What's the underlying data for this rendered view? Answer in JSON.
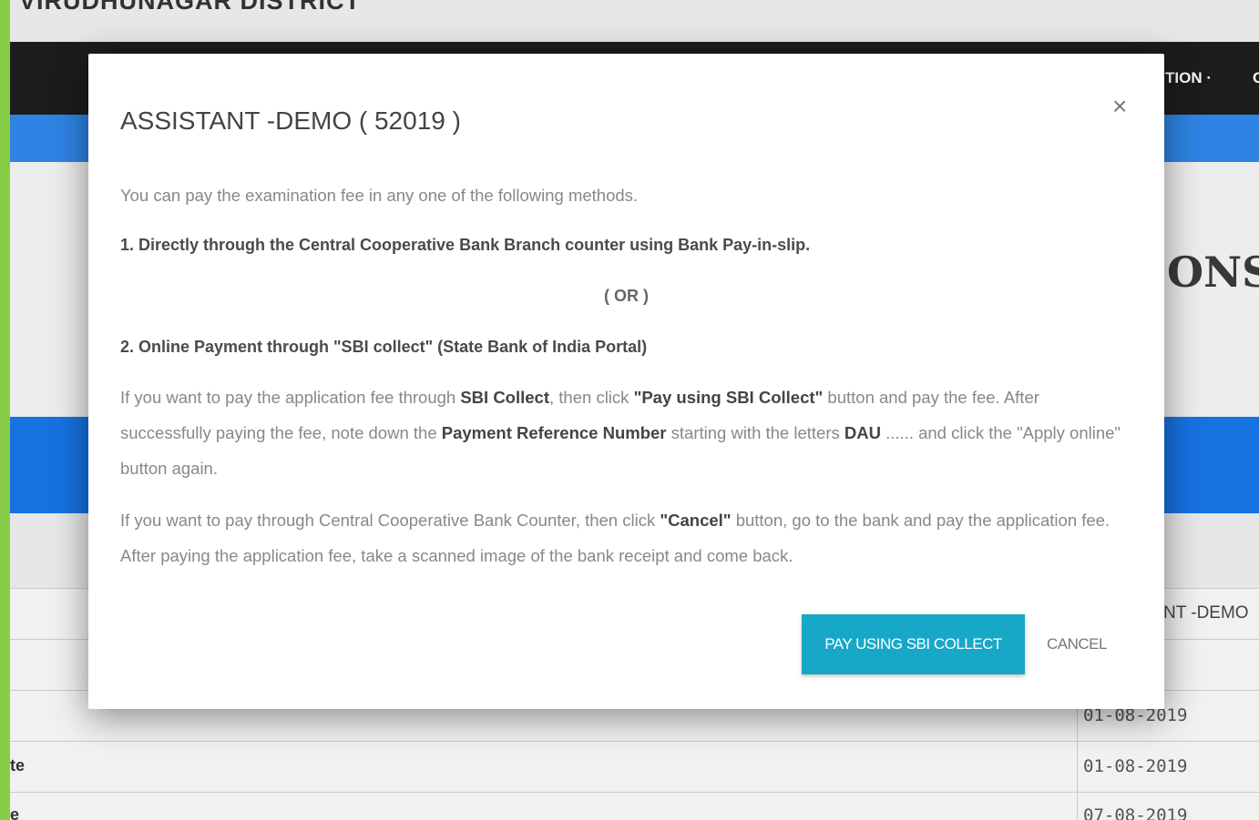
{
  "background": {
    "district_title": "VIRUDHUNAGAR DISTRICT",
    "nav_items": [
      "TION ·",
      "C"
    ],
    "heading_fragment": "ONS",
    "table": {
      "header_fragment": "NT -DEMO",
      "rows": [
        {
          "left": "",
          "date": "01-08-2019"
        },
        {
          "left": "te",
          "date": "01-08-2019"
        },
        {
          "left": "e",
          "date": "07-08-2019"
        }
      ]
    }
  },
  "modal": {
    "title": "ASSISTANT -DEMO ( 52019 )",
    "close_symbol": "×",
    "intro": "You can pay the examination fee in any one of the following methods.",
    "option1": "1. Directly through the Central Cooperative Bank Branch counter using Bank Pay-in-slip.",
    "or_text": "( OR )",
    "option2": "2. Online Payment through \"SBI collect\" (State Bank of India Portal)",
    "sbi_para": {
      "part1": "If you want to pay the application fee through ",
      "sbi_collect": "SBI Collect",
      "part2": ", then click ",
      "pay_label": "\"Pay using SBI Collect\"",
      "part3": " button and pay the fee. After successfully paying the fee, note down the ",
      "ref_number": "Payment Reference Number",
      "part4": " starting with the letters ",
      "dau": "DAU",
      "part5": " ...... and click the \"Apply online\" button again."
    },
    "bank_para": {
      "part1": "If you want to pay through Central Cooperative Bank Counter, then click ",
      "cancel_label": "\"Cancel\"",
      "part2": " button, go to the bank and pay the application fee. After paying the application fee, take a scanned image of the bank receipt and come back."
    },
    "pay_button": "PAY USING SBI COLLECT",
    "cancel_button": "CANCEL"
  },
  "colors": {
    "border_green": "#8bd24a",
    "navbar": "#1d1d1d",
    "blue_bar": "#2f86e8",
    "pay_button": "#17a8c8"
  }
}
